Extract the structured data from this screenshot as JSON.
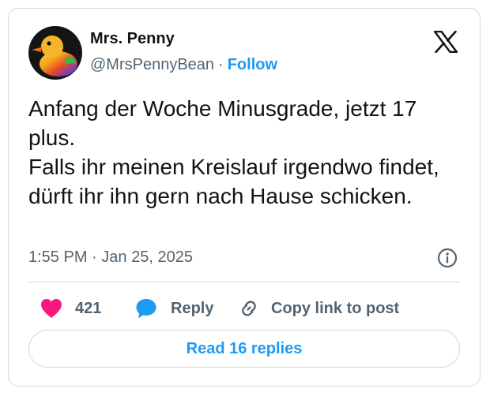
{
  "author": {
    "name": "Mrs. Penny",
    "handle": "@MrsPennyBean",
    "separator": "·",
    "follow_label": "Follow"
  },
  "tweet": {
    "lines": [
      "Anfang der Woche Minusgrade, jetzt 17 plus.",
      "Falls ihr meinen Kreislauf irgendwo findet, dürft ihr ihn gern nach Hause schicken."
    ],
    "time": "1:55 PM",
    "separator": "·",
    "date": "Jan 25, 2025"
  },
  "actions": {
    "like_count": "421",
    "reply_label": "Reply",
    "copy_link_label": "Copy link to post"
  },
  "read_replies_label": "Read 16 replies",
  "icons": {
    "platform_logo": "x-logo-icon",
    "info": "info-icon",
    "like": "heart-icon",
    "reply": "speech-bubble-icon",
    "copy_link": "link-icon"
  },
  "colors": {
    "accent": "#1d9bf0",
    "heart": "#f91880",
    "secondary_text": "#536471",
    "border": "#cfd9de"
  }
}
